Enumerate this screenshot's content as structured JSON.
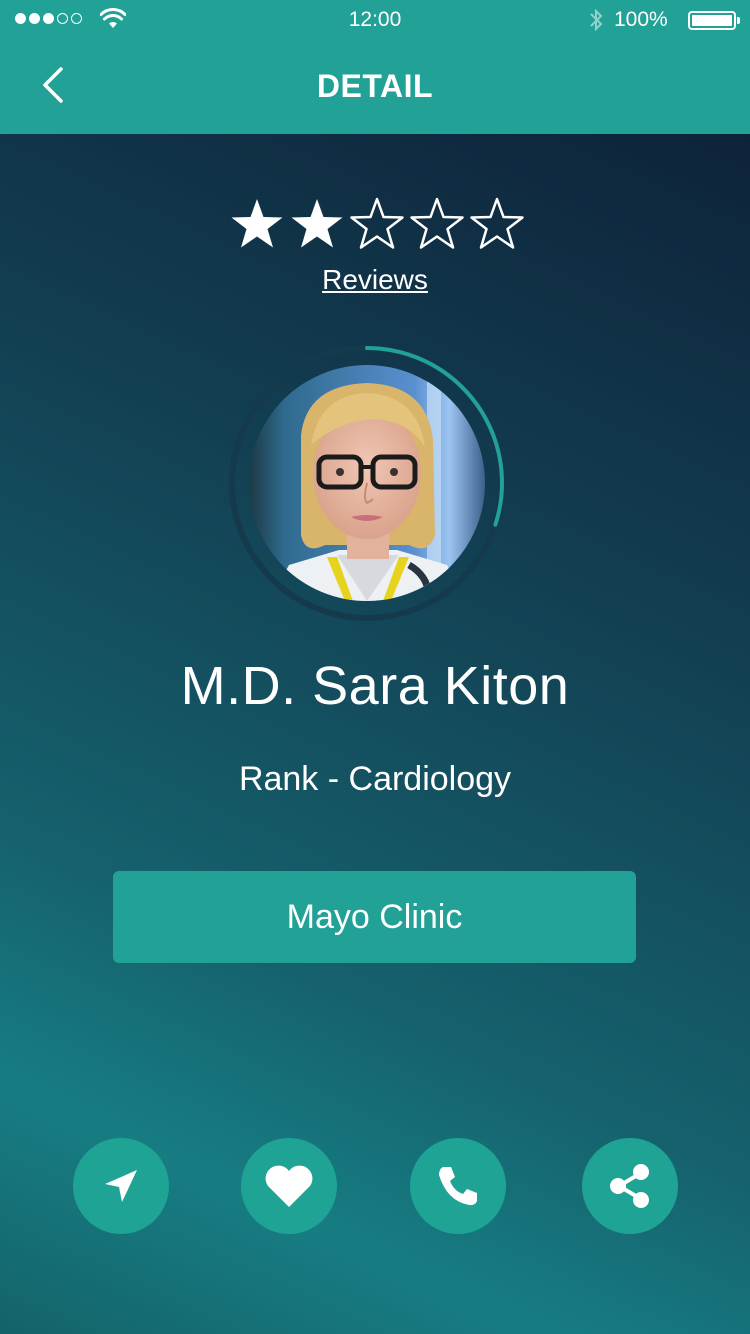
{
  "status_bar": {
    "time": "12:00",
    "battery_percent": "100%",
    "signal_bars_filled": 3,
    "signal_bars_total": 5
  },
  "nav": {
    "title": "DETAIL",
    "back_icon": "chevron-left-icon"
  },
  "rating": {
    "stars_filled": 2,
    "stars_total": 5,
    "reviews_label": "Reviews",
    "progress_fraction": 0.3
  },
  "doctor": {
    "name": "M.D. Sara Kiton",
    "rank": "Rank - Cardiology",
    "clinic": "Mayo Clinic"
  },
  "actions": [
    {
      "icon": "navigation-arrow-icon"
    },
    {
      "icon": "heart-icon"
    },
    {
      "icon": "phone-icon"
    },
    {
      "icon": "share-icon"
    }
  ],
  "colors": {
    "accent": "#22a196",
    "action_button": "#1ea394",
    "background_top": "#0c1c33",
    "background_bottom": "#177d83"
  }
}
